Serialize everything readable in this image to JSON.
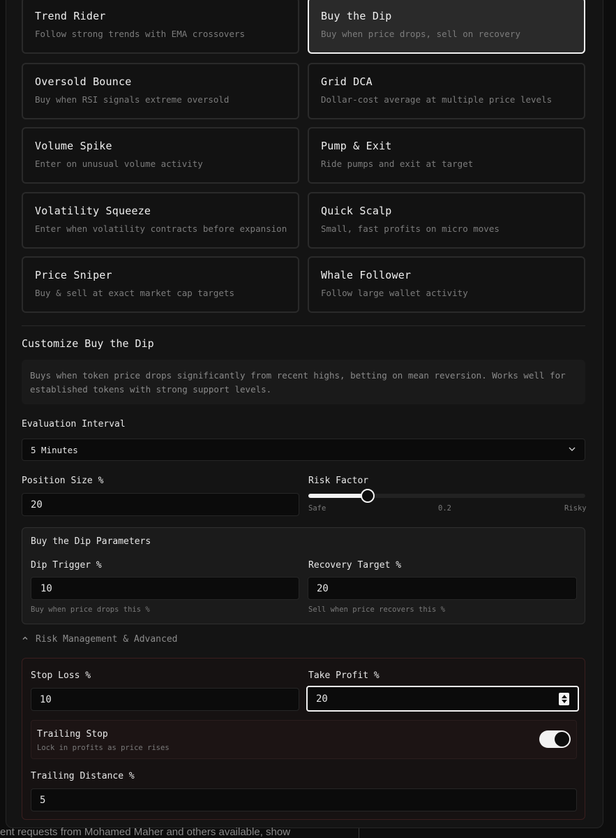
{
  "strategies": [
    {
      "name": "Trend Rider",
      "desc": "Follow strong trends with EMA crossovers",
      "selected": false
    },
    {
      "name": "Buy the Dip",
      "desc": "Buy when price drops, sell on recovery",
      "selected": true
    },
    {
      "name": "Oversold Bounce",
      "desc": "Buy when RSI signals extreme oversold",
      "selected": false
    },
    {
      "name": "Grid DCA",
      "desc": "Dollar-cost average at multiple price levels",
      "selected": false
    },
    {
      "name": "Volume Spike",
      "desc": "Enter on unusual volume activity",
      "selected": false
    },
    {
      "name": "Pump & Exit",
      "desc": "Ride pumps and exit at target",
      "selected": false
    },
    {
      "name": "Volatility Squeeze",
      "desc": "Enter when volatility contracts before expansion",
      "selected": false
    },
    {
      "name": "Quick Scalp",
      "desc": "Small, fast profits on micro moves",
      "selected": false
    },
    {
      "name": "Price Sniper",
      "desc": "Buy & sell at exact market cap targets",
      "selected": false
    },
    {
      "name": "Whale Follower",
      "desc": "Follow large wallet activity",
      "selected": false
    }
  ],
  "customize": {
    "title": "Customize Buy the Dip",
    "description": "Buys when token price drops significantly from recent highs, betting on mean reversion. Works well for established tokens with strong support levels."
  },
  "evaluation": {
    "label": "Evaluation Interval",
    "value": "5 Minutes"
  },
  "position_size": {
    "label": "Position Size %",
    "value": "20"
  },
  "risk_factor": {
    "label": "Risk Factor",
    "min_label": "Safe",
    "value_label": "0.2",
    "max_label": "Risky",
    "value": 0.2
  },
  "dip_params": {
    "title": "Buy the Dip Parameters",
    "dip_trigger": {
      "label": "Dip Trigger %",
      "value": "10",
      "hint": "Buy when price drops this %"
    },
    "recovery_target": {
      "label": "Recovery Target %",
      "value": "20",
      "hint": "Sell when price recovers this %"
    }
  },
  "advanced": {
    "toggle_label": "Risk Management & Advanced",
    "stop_loss": {
      "label": "Stop Loss %",
      "value": "10"
    },
    "take_profit": {
      "label": "Take Profit %",
      "value": "20"
    },
    "trailing_stop": {
      "label": "Trailing Stop",
      "desc": "Lock in profits as price rises",
      "enabled": true
    },
    "trailing_distance": {
      "label": "Trailing Distance %",
      "value": "5"
    }
  },
  "background_text": "ent requests from Mohamed Maher and others available, show"
}
